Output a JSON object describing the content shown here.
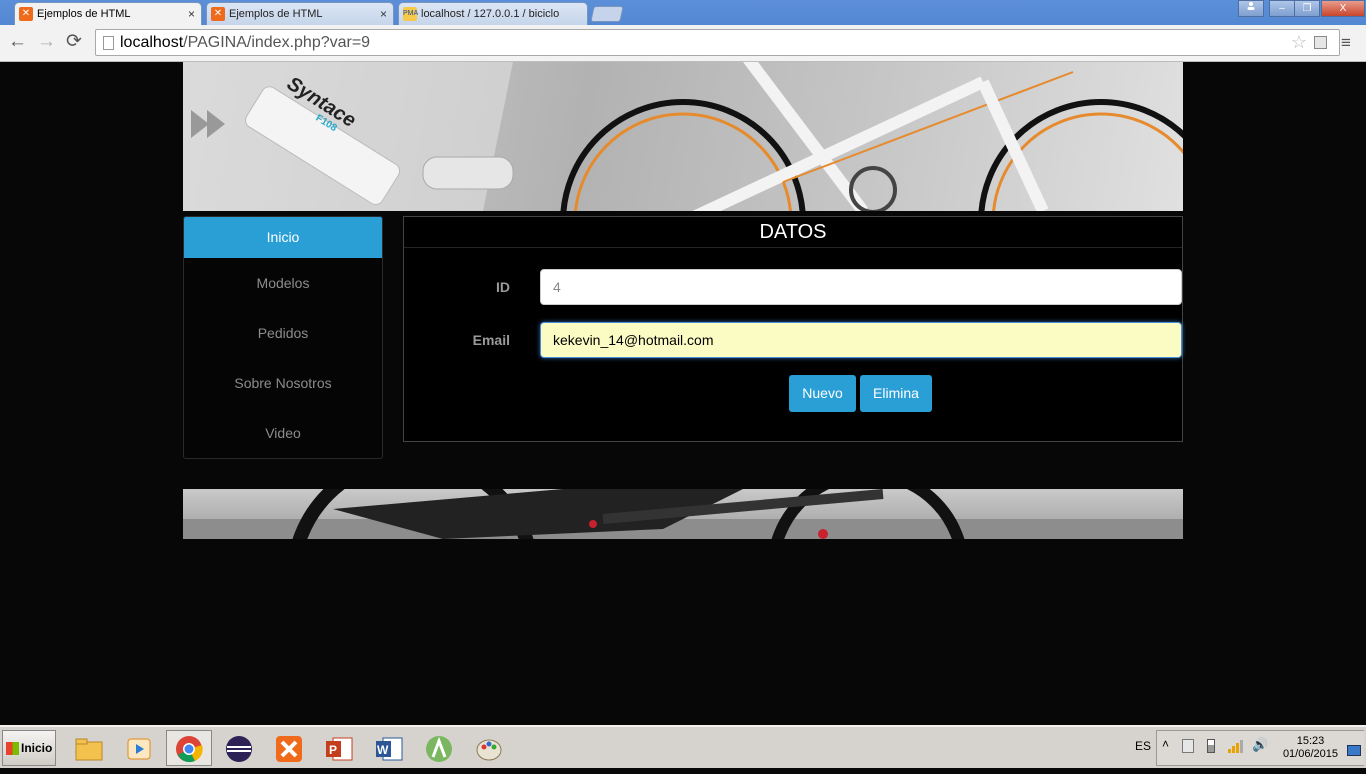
{
  "browser": {
    "tabs": [
      {
        "title": "Ejemplos de HTML",
        "active": true,
        "icon": "xampp-icon"
      },
      {
        "title": "Ejemplos de HTML",
        "active": false,
        "icon": "xampp-icon"
      },
      {
        "title": "localhost / 127.0.0.1 / biciclo",
        "active": false,
        "icon": "phpmyadmin-icon"
      }
    ],
    "tab_close_glyph": "×",
    "url_host": "localhost",
    "url_path": "/PAGINA/index.php?var=9",
    "window_buttons": {
      "minimize": "–",
      "restore": "❐",
      "close": "X"
    },
    "nav": {
      "back": "←",
      "forward": "→",
      "reload": "⟳",
      "menu": "≡",
      "star": "☆"
    }
  },
  "sidebar": {
    "items": [
      {
        "label": "Inicio",
        "active": true
      },
      {
        "label": "Modelos",
        "active": false
      },
      {
        "label": "Pedidos",
        "active": false
      },
      {
        "label": "Sobre Nosotros",
        "active": false
      },
      {
        "label": "Video",
        "active": false
      }
    ]
  },
  "form": {
    "title": "DATOS",
    "id_label": "ID",
    "id_value": "4",
    "email_label": "Email",
    "email_value": "kekevin_14@hotmail.com",
    "buttons": {
      "new": "Nuevo",
      "delete": "Elimina"
    }
  },
  "banner": {
    "brand_text": "Syntace",
    "model_text": "F108"
  },
  "taskbar": {
    "start_label": "Inicio",
    "apps": [
      "file-explorer",
      "media-player",
      "chrome",
      "eclipse",
      "xampp",
      "powerpoint",
      "word",
      "android-studio",
      "paint"
    ],
    "language": "ES",
    "time": "15:23",
    "date": "01/06/2015"
  },
  "colors": {
    "accent": "#2a9fd6",
    "page_bg": "#070707",
    "autofill": "#fbfcc4"
  }
}
